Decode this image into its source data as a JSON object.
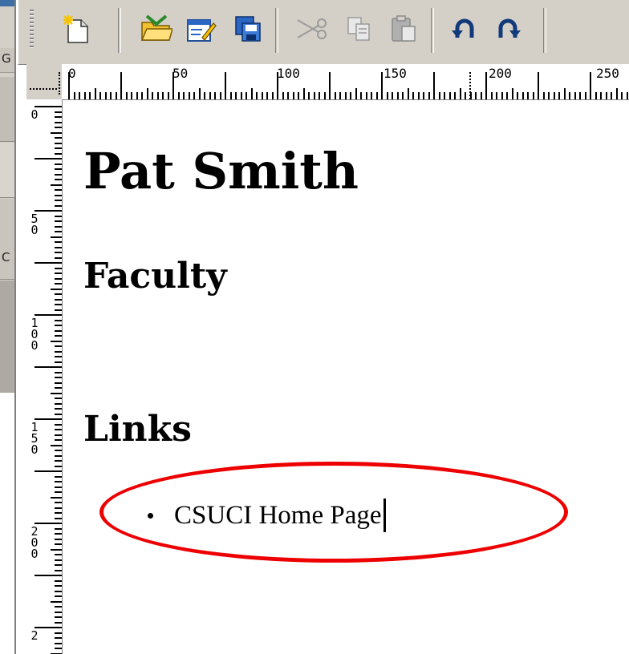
{
  "toolbar": {
    "buttons": [
      {
        "name": "new-page-button",
        "icon": "new-page-icon"
      },
      {
        "name": "open-button",
        "icon": "open-folder-icon"
      },
      {
        "name": "edit-button",
        "icon": "edit-icon"
      },
      {
        "name": "save-button",
        "icon": "save-icon"
      },
      {
        "name": "cut-button",
        "icon": "scissors-icon",
        "disabled": true
      },
      {
        "name": "copy-button",
        "icon": "copy-icon",
        "disabled": true
      },
      {
        "name": "paste-button",
        "icon": "paste-icon",
        "disabled": true
      },
      {
        "name": "undo-button",
        "icon": "undo-icon"
      },
      {
        "name": "redo-button",
        "icon": "redo-icon"
      }
    ]
  },
  "rulers": {
    "horizontal_labels": [
      "0",
      "50",
      "100",
      "150",
      "200",
      "250"
    ],
    "vertical_labels": [
      "0",
      "50",
      "100",
      "150",
      "200",
      "2"
    ]
  },
  "left_strip": {
    "letters": [
      "G",
      "C"
    ]
  },
  "document": {
    "title": "Pat Smith",
    "headings": [
      "Faculty",
      "Links"
    ],
    "list_items": [
      "CSUCI Home Page"
    ]
  },
  "colors": {
    "highlight": "#ee0000",
    "toolbar_bg": "#d4d0c8"
  }
}
